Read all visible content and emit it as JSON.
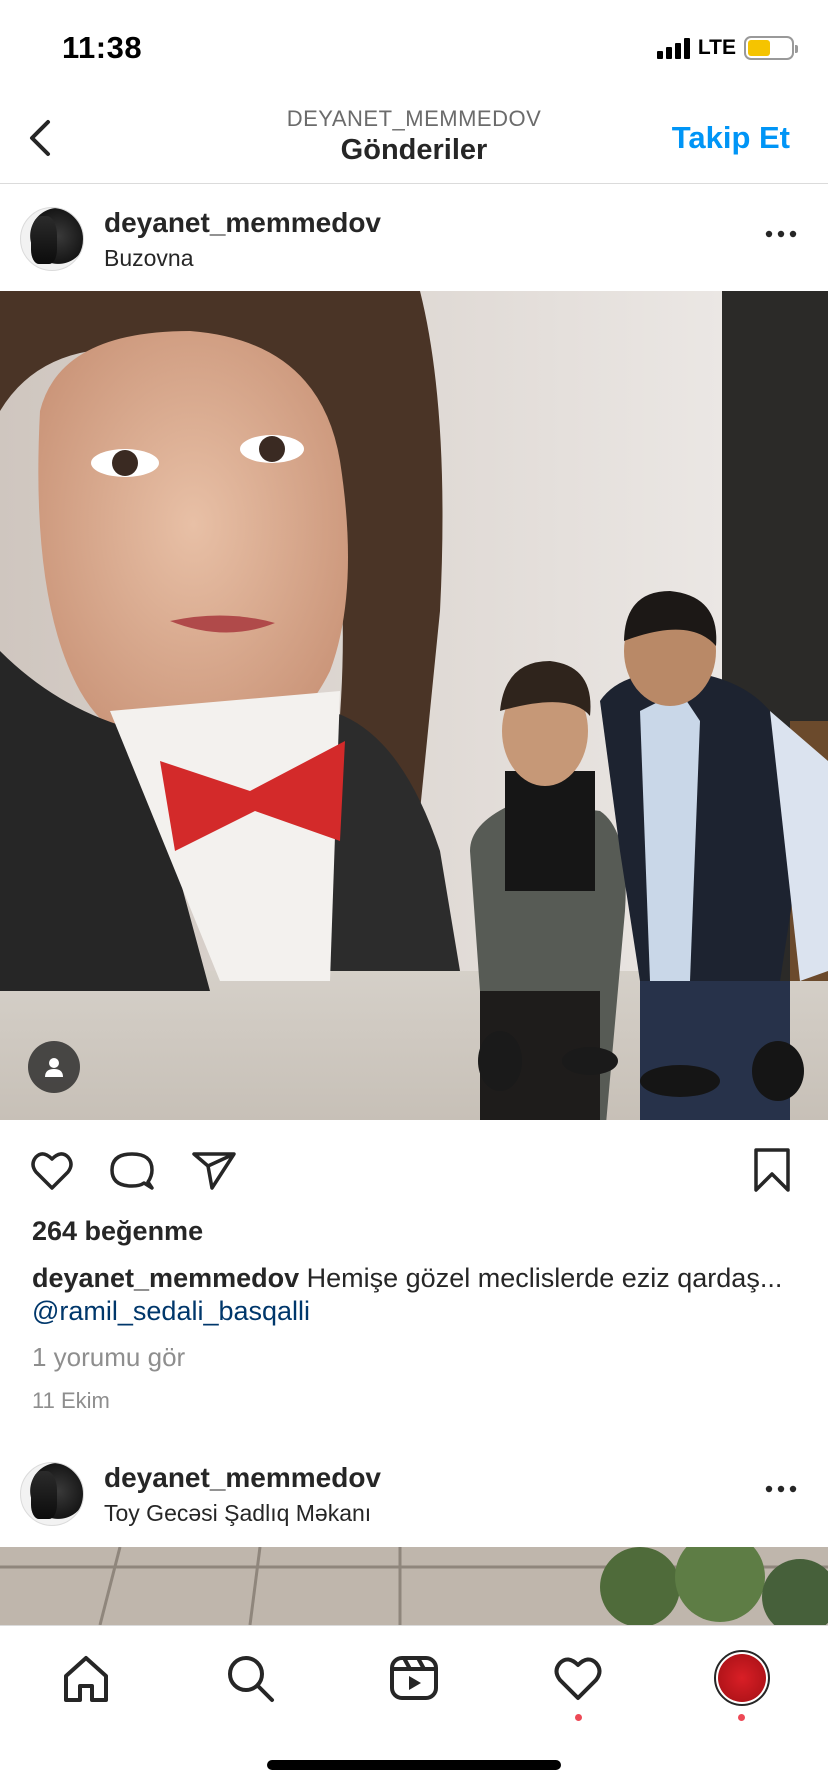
{
  "status_bar": {
    "time": "11:38",
    "network": "LTE"
  },
  "header": {
    "subtitle": "DEYANET_MEMMEDOV",
    "title": "Gönderiler",
    "follow_label": "Takip Et"
  },
  "posts": [
    {
      "username": "deyanet_memmedov",
      "location": "Buzovna",
      "likes": "264 beğenme",
      "caption_user": "deyanet_memmedov",
      "caption_text": "Hemişe gözel meclislerde eziz qardaş...",
      "caption_mention": "@ramil_sedali_basqalli",
      "comments_link": "1 yorumu gör",
      "date": "11 Ekim"
    },
    {
      "username": "deyanet_memmedov",
      "location": "Toy Gecəsi Şadlıq Məkanı"
    }
  ],
  "icons": {
    "back": "chevron-left-icon",
    "more": "more-horizontal-icon",
    "like": "heart-icon",
    "comment": "comment-icon",
    "share": "send-icon",
    "save": "bookmark-icon",
    "tag": "user-tag-icon"
  },
  "colors": {
    "accent": "#0095f6",
    "mention": "#00376b",
    "notification": "#ed4956"
  }
}
